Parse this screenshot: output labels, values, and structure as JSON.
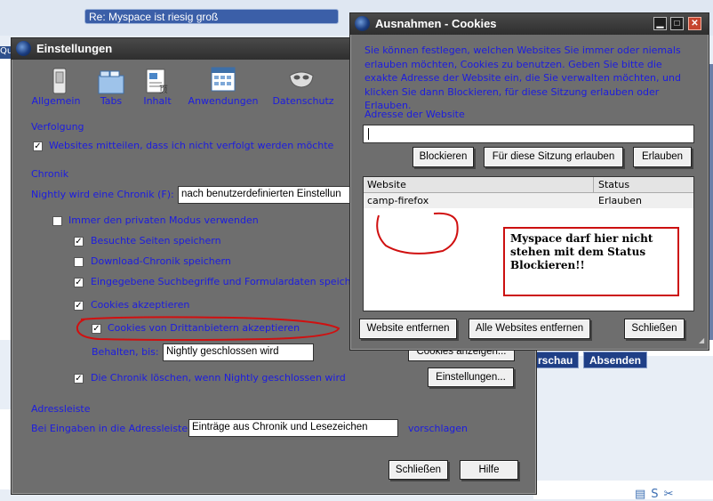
{
  "background": {
    "thread_title": "Re: Myspace ist riesig groß",
    "left_tab": "Qu",
    "buttons": {
      "preview": "rschau",
      "submit": "Absenden"
    }
  },
  "settings": {
    "title": "Einstellungen",
    "tabs": [
      {
        "label": "Allgemein",
        "icon": "switch-icon"
      },
      {
        "label": "Tabs",
        "icon": "tabs-icon"
      },
      {
        "label": "Inhalt",
        "icon": "content-icon"
      },
      {
        "label": "Anwendungen",
        "icon": "applications-icon"
      },
      {
        "label": "Datenschutz",
        "icon": "privacy-mask-icon"
      }
    ],
    "tracking_heading": "Verfolgung",
    "tracking_checkbox": "Websites mitteilen, dass ich nicht verfolgt werden möchte",
    "history_heading": "Chronik",
    "history_label": "Nightly wird eine Chronik (F):",
    "history_select": "nach benutzerdefinierten Einstellun",
    "private_mode": "Immer den privaten Modus verwenden",
    "visited": "Besuchte Seiten speichern",
    "downloads": "Download-Chronik speichern",
    "search_forms": "Eingegebene Suchbegriffe und Formulardaten speiche",
    "accept_cookies": "Cookies akzeptieren",
    "third_party": "Cookies von Drittanbietern akzeptieren",
    "keep_label": "Behalten, bis:",
    "keep_select": "Nightly geschlossen wird",
    "show_cookies": "Cookies anzeigen...",
    "clear_history": "Die Chronik löschen, wenn Nightly geschlossen wird",
    "settings_button": "Einstellungen...",
    "addressbar_heading": "Adressleiste",
    "addressbar_label": "Bei Eingaben in die Adressleiste",
    "addressbar_select": "Einträge aus Chronik und Lesezeichen",
    "addressbar_suffix": "vorschlagen",
    "close": "Schließen",
    "help": "Hilfe"
  },
  "exceptions": {
    "title": "Ausnahmen - Cookies",
    "description": "Sie können festlegen, welchen Websites Sie immer oder niemals erlauben möchten, Cookies zu benutzen. Geben Sie bitte die exakte Adresse der Website ein, die Sie verwalten möchten, und klicken Sie dann Blockieren, für diese Sitzung erlauben oder Erlauben.",
    "address_label": "Adresse der Website",
    "address_value": "",
    "block": "Blockieren",
    "allow_session": "Für diese Sitzung erlauben",
    "allow": "Erlauben",
    "columns": {
      "website": "Website",
      "status": "Status"
    },
    "rows": [
      {
        "website": "camp-firefox",
        "status": "Erlauben"
      }
    ],
    "remove": "Website entfernen",
    "remove_all": "Alle Websites entfernen",
    "close": "Schließen"
  },
  "annotation": "Myspace darf hier nicht stehen mit dem Status Blockieren!!"
}
